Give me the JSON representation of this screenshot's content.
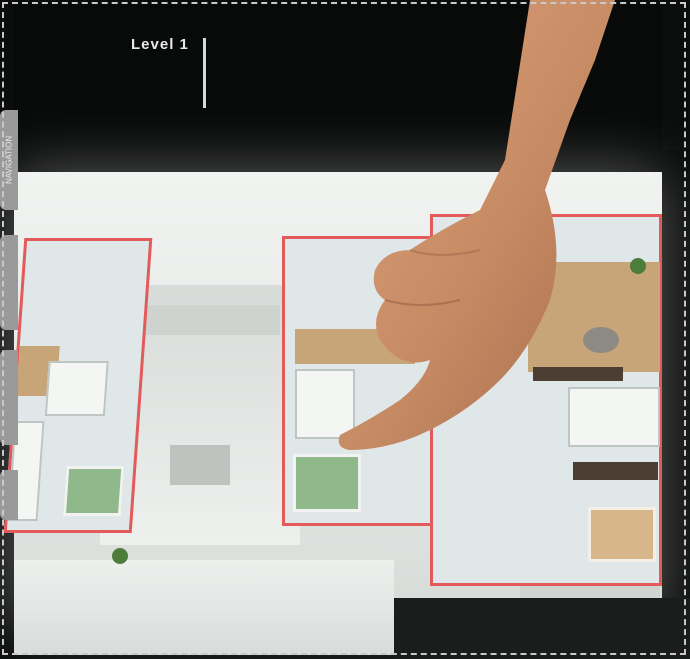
{
  "level_label": "Level 1",
  "side_tabs": [
    "NAVIGATION",
    "",
    "",
    ""
  ],
  "info_text": [
    "",
    "",
    ""
  ],
  "colors": {
    "plan_outline": "#e25a5a",
    "board": "#eef0ee",
    "background": "#0b0d0c",
    "bed": "#8fb98a",
    "wood_floor": "#c7a579"
  },
  "icons": {
    "hand": "pointing-hand-icon"
  }
}
